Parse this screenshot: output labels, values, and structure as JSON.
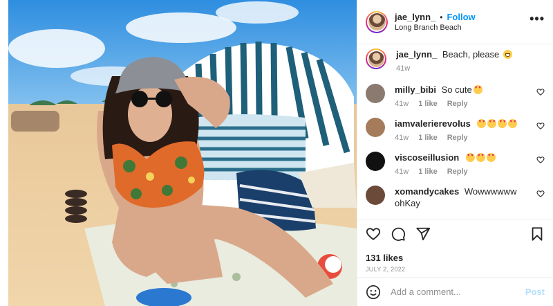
{
  "post": {
    "image_alt": "Woman in bucket hat and sunglasses sitting on a beach towel in front of a striped beach tent"
  },
  "header": {
    "username": "jae_lynn_",
    "separator": "•",
    "follow_label": "Follow",
    "location": "Long Branch Beach",
    "more_label": "•••"
  },
  "caption": {
    "username": "jae_lynn_",
    "text": "Beach, please",
    "emoji": "grin",
    "time": "41w"
  },
  "comments": [
    {
      "username": "milly_bibi",
      "text": "So cute",
      "emojis": [
        "heart-eyes"
      ],
      "time": "41w",
      "likes": "1 like",
      "reply": "Reply",
      "avatar_color": "#8a7a70"
    },
    {
      "username": "iamvalerierevolus",
      "text": "",
      "emojis": [
        "heart-eyes",
        "heart-eyes",
        "heart-eyes",
        "heart-eyes"
      ],
      "time": "41w",
      "likes": "1 like",
      "reply": "Reply",
      "avatar_color": "#a57c5b"
    },
    {
      "username": "viscoseillusion",
      "text": "",
      "emojis": [
        "heart-eyes",
        "heart-eyes",
        "heart-eyes"
      ],
      "time": "41w",
      "likes": "1 like",
      "reply": "Reply",
      "avatar_color": "#111111"
    },
    {
      "username": "xomandycakes",
      "text": "Wowwwwww ohKay",
      "emojis": [],
      "time": "",
      "likes": "",
      "reply": "",
      "avatar_color": "#6b4a3a"
    }
  ],
  "actions": {
    "like_icon": "heart-outline-icon",
    "comment_icon": "comment-bubble-icon",
    "share_icon": "paper-plane-icon",
    "save_icon": "bookmark-icon"
  },
  "likes": "131 likes",
  "date": "JULY 2, 2022",
  "add_comment": {
    "placeholder": "Add a comment...",
    "post_label": "Post",
    "emoji_icon": "smiley-icon"
  },
  "colors": {
    "accent": "#0095f6",
    "post_disabled": "#b2dffc",
    "muted": "#8e8e8e"
  }
}
